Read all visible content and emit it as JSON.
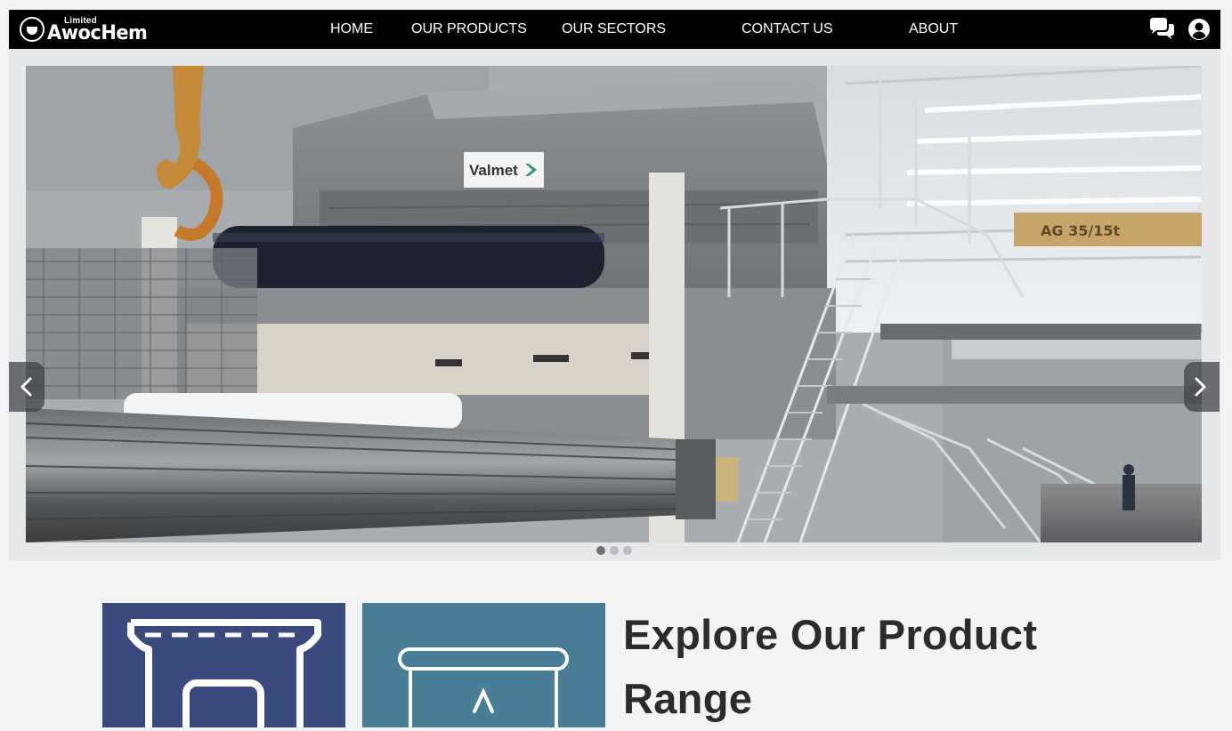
{
  "brand": {
    "limited": "Limited",
    "name": "AwocHem"
  },
  "nav": {
    "items": [
      {
        "label": "HOME"
      },
      {
        "label": "OUR PRODUCTS"
      },
      {
        "label": "OUR SECTORS"
      },
      {
        "label": "CONTACT US"
      },
      {
        "label": "ABOUT"
      }
    ],
    "icons": [
      "chat-bubbles-icon",
      "user-account-icon"
    ]
  },
  "carousel": {
    "slide_sign_text": "Valmet",
    "crane_text": "AG 35/15t",
    "slide_count": 3,
    "active_slide": 1,
    "prev_icon": "chevron-left-icon",
    "next_icon": "chevron-right-icon"
  },
  "products": {
    "heading": "Explore Our Product Range",
    "tiles": [
      {
        "icon": "product-machine-icon",
        "color": "#3b4a7c"
      },
      {
        "icon": "product-container-icon",
        "color": "#4a7d96"
      }
    ]
  },
  "colors": {
    "navbar": "#000000",
    "page_background": "#f2f3f5",
    "tile_navy": "#3b4a7c",
    "tile_teal": "#4a7d96",
    "heading": "#2b2b2b"
  }
}
